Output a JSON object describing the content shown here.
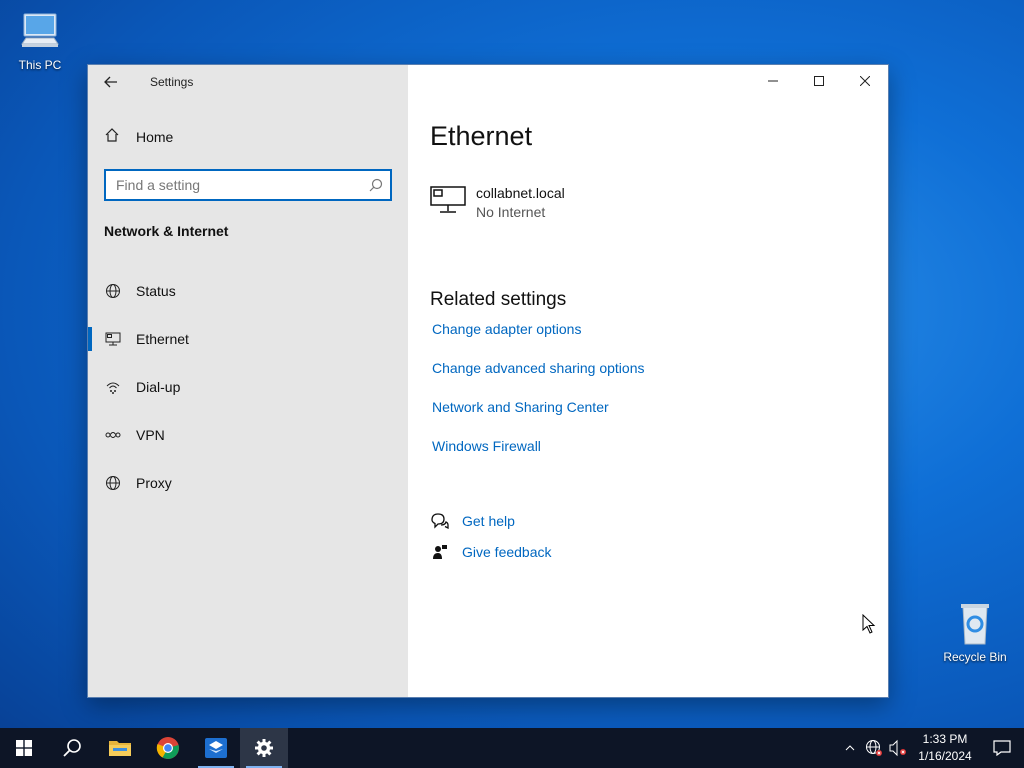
{
  "desktop": {
    "this_pc_label": "This PC",
    "recycle_bin_label": "Recycle Bin"
  },
  "window": {
    "app_title": "Settings",
    "nav": {
      "home_label": "Home",
      "search_placeholder": "Find a setting",
      "section_title": "Network & Internet",
      "items": [
        {
          "label": "Status",
          "icon": "status-globe-icon"
        },
        {
          "label": "Ethernet",
          "icon": "ethernet-icon",
          "selected": true
        },
        {
          "label": "Dial-up",
          "icon": "dialup-icon"
        },
        {
          "label": "VPN",
          "icon": "vpn-icon"
        },
        {
          "label": "Proxy",
          "icon": "proxy-globe-icon"
        }
      ]
    },
    "content": {
      "page_title": "Ethernet",
      "connection": {
        "name": "collabnet.local",
        "status": "No Internet"
      },
      "related_title": "Related settings",
      "related_links": [
        "Change adapter options",
        "Change advanced sharing options",
        "Network and Sharing Center",
        "Windows Firewall"
      ],
      "help_links": [
        {
          "label": "Get help",
          "icon": "get-help-icon"
        },
        {
          "label": "Give feedback",
          "icon": "feedback-icon"
        }
      ]
    }
  },
  "taskbar": {
    "apps": [
      "start-icon",
      "search-icon",
      "file-explorer-icon",
      "chrome-icon",
      "app-icon",
      "settings-icon"
    ],
    "clock_time": "1:33 PM",
    "clock_date": "1/16/2024"
  },
  "colors": {
    "accent": "#0067c0",
    "nav_bg": "#e6e6e6",
    "taskbar_bg": "#0d1526"
  }
}
